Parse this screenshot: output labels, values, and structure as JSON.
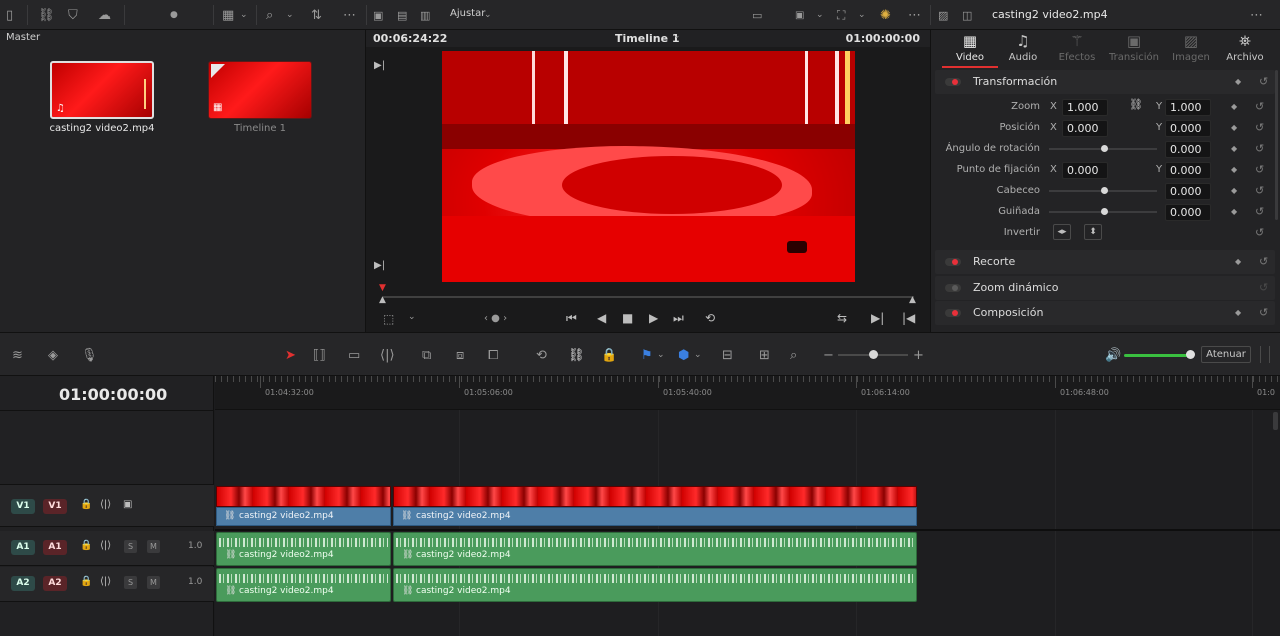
{
  "topbar": {
    "view_label": "Ajustar",
    "panel_title": "casting2 video2.mp4"
  },
  "media_pool": {
    "bin_label": "Master",
    "clips": [
      {
        "name": "casting2 video2.mp4",
        "badge": "♫",
        "selected": true
      },
      {
        "name": "Timeline 1",
        "badge": "▦",
        "selected": false
      }
    ]
  },
  "viewer": {
    "source_timecode": "00:06:24:22",
    "timeline_name": "Timeline 1",
    "record_timecode": "01:00:00:00"
  },
  "inspector": {
    "tabs": [
      {
        "label": "Video",
        "icon": "film-icon",
        "active": true
      },
      {
        "label": "Audio",
        "icon": "music-note-icon",
        "active": false
      },
      {
        "label": "Efectos",
        "icon": "wand-icon",
        "active": false
      },
      {
        "label": "Transición",
        "icon": "transition-icon",
        "active": false
      },
      {
        "label": "Imagen",
        "icon": "image-icon",
        "active": false
      },
      {
        "label": "Archivo",
        "icon": "camera-icon",
        "active": false
      }
    ],
    "transform": {
      "title": "Transformación",
      "zoom": {
        "label": "Zoom",
        "x": "1.000",
        "y": "1.000"
      },
      "position": {
        "label": "Posición",
        "x": "0.000",
        "y": "0.000"
      },
      "rotation": {
        "label": "Ángulo de rotación",
        "value": "0.000"
      },
      "anchor": {
        "label": "Punto de fijación",
        "x": "0.000",
        "y": "0.000"
      },
      "pitch": {
        "label": "Cabeceo",
        "value": "0.000"
      },
      "yaw": {
        "label": "Guiñada",
        "value": "0.000"
      },
      "flip": {
        "label": "Invertir"
      },
      "axis_x": "X",
      "axis_y": "Y"
    },
    "sections": [
      {
        "title": "Recorte",
        "enabled": true
      },
      {
        "title": "Zoom dinámico",
        "enabled": false
      },
      {
        "title": "Composición",
        "enabled": true
      }
    ]
  },
  "edit_toolbar": {
    "dim_label": "Atenuar"
  },
  "timeline": {
    "timecode": "01:00:00:00",
    "ruler": [
      "01:04:32:00",
      "01:05:06:00",
      "01:05:40:00",
      "01:06:14:00",
      "01:06:48:00",
      "01:0"
    ],
    "tracks": [
      {
        "id": "V1",
        "dest": "V1",
        "type": "video"
      },
      {
        "id": "A1",
        "dest": "A1",
        "type": "audio",
        "level": "1.0",
        "solo": "S",
        "mute": "M"
      },
      {
        "id": "A2",
        "dest": "A2",
        "type": "audio",
        "level": "1.0",
        "solo": "S",
        "mute": "M"
      }
    ],
    "clip_names": {
      "v1_a": "casting2 video2.mp4",
      "v1_b": "casting2 video2.mp4",
      "a1_a": "casting2 video2.mp4",
      "a1_b": "casting2 video2.mp4",
      "a2_a": "casting2 video2.mp4",
      "a2_b": "casting2 video2.mp4"
    }
  }
}
